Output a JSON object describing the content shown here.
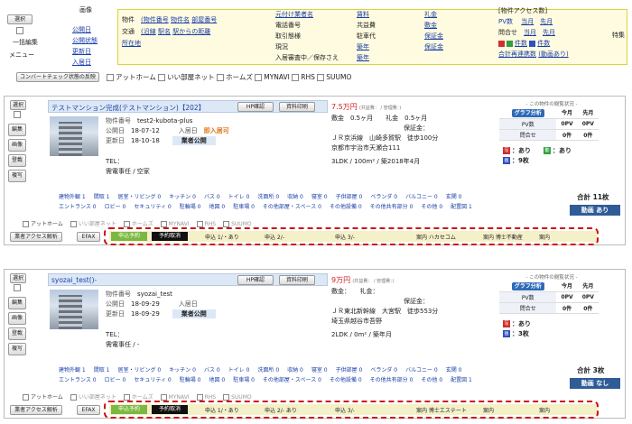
{
  "header": {
    "select_label": "選択",
    "bulk_edit": "一括編集",
    "menu": "メニュー",
    "col_image": {
      "title": "画像",
      "links": [
        "公開日",
        "公開状態",
        "更新日",
        "入居日"
      ]
    },
    "col_property": {
      "rows": [
        [
          "物件",
          "(物件番号",
          "物件名",
          "部屋番号"
        ],
        [
          "交通",
          "(沿線",
          "駅名",
          "駅からの距離"
        ],
        [
          "所在地",
          ""
        ]
      ]
    },
    "col_owner": {
      "items": [
        "元付け業者名",
        "電話番号",
        "取引態様",
        "現況",
        "入居審査中／保存さえ"
      ]
    },
    "col_price": {
      "items": [
        "賃料",
        "共益費",
        "駐車代",
        "築年",
        "築年"
      ]
    },
    "col_deposit": {
      "items": [
        "礼金",
        "敷金",
        "保証金",
        "保証金"
      ]
    },
    "access_title": "[物件アクセス数]",
    "pv_label": "PV数",
    "pv_links": [
      "当月",
      "先月"
    ],
    "inquiry_label": "問合せ",
    "inquiry_links": [
      "当月",
      "先月"
    ],
    "site_count": "件数",
    "site_count2": "件数",
    "total_link": "合計再連携数",
    "total_link2": "(動画あり)",
    "special": "特集",
    "convert_btn": "コンバートチェック状態の反映",
    "portal_checks": [
      "アットホーム",
      "いい部屋ネット",
      "ホームズ",
      "MYNAVI",
      "RHS",
      "SUUMO"
    ]
  },
  "cards": [
    {
      "select": "選択",
      "side_buttons": [
        "編集",
        "画像",
        "登載",
        "複写"
      ],
      "title": "テストマンション完成(テストマンション)【202】",
      "hp_btn": "HP確認",
      "print_btn": "資料印刷",
      "prop_no_label": "物件番号",
      "prop_no": "test2-kubota-plus",
      "pub_label": "公開日",
      "pub_date": "18-07-12",
      "move_label": "入居日",
      "move_val": "即入居可",
      "upd_label": "更新日",
      "upd_date": "18-10-18",
      "status": "業者公開",
      "tel": "TEL：",
      "agent": "需電事任 / 空家",
      "price": "7.5万円",
      "price_note": "(共益費： / 管理費：)",
      "deposit": "敷金　0.5ヶ月",
      "key_money": "礼金　0.5ヶ月",
      "guarantee": "保証金：",
      "station": "ＪＲ京浜線　山崎多賀駅　徒歩100分",
      "address": "京都市宇治市天瀬合111",
      "spec": "3LDK / 100m² / 築2018年4月",
      "stat_title": "- この物件の閲覧状況 -",
      "graph_btn": "グラフ分析",
      "th_this": "今月",
      "th_prev": "先月",
      "pv_label": "PV数",
      "pv_this": "0PV",
      "pv_prev": "0PV",
      "inq_label": "問合せ",
      "inq_this": "0件",
      "inq_prev": "0件",
      "badges": [
        {
          "icon": "写",
          "text": "：あり",
          "color": "#d03030"
        },
        {
          "icon": "動",
          "text": "：あり",
          "color": "#30a040"
        },
        {
          "icon": "画",
          "text": "：9枚",
          "color": "#3050c0"
        }
      ],
      "features": [
        "建物外観 1",
        "間取 1",
        "居室・リビング 0",
        "キッチン 0",
        "バス 0",
        "トイレ 0",
        "洗面所 0",
        "収納 0",
        "寝室 0",
        "子供部屋 0",
        "ベランダ 0",
        "バルコニー 0",
        "玄関 0",
        "エントランス 0",
        "ロビー 0",
        "セキュリティ 0",
        "駐輪場 0",
        "地図 0",
        "駐車場 0",
        "その他部屋・スペース 0",
        "その他設備 0",
        "その他共有部分 0",
        "その他 0",
        "配置図 1"
      ],
      "total": "合計 11枚",
      "video": "動画 あり",
      "portals": [
        "アットホーム",
        "いい部屋ネット",
        "ホームズ",
        "MYNAVI",
        "RHS",
        "SUUMO"
      ],
      "access_btn": "業者アクセス解析",
      "efax": "EFAX",
      "reserve": "申込予約",
      "cancel": "予約取消",
      "apps": [
        "申込 1/・あり",
        "申込 2/-",
        "申込 3/-"
      ],
      "guides": [
        "案内 ハカセコム",
        "案内 博士不動産",
        "案内"
      ]
    },
    {
      "select": "選択",
      "side_buttons": [
        "編集",
        "画像",
        "登載",
        "複写"
      ],
      "title": "syozai_test()-",
      "hp_btn": "HP確認",
      "print_btn": "資料印刷",
      "prop_no_label": "物件番号",
      "prop_no": "syozai_test",
      "pub_label": "公開日",
      "pub_date": "18-09-29",
      "move_label": "入居日",
      "move_val": "",
      "upd_label": "更新日",
      "upd_date": "18-09-29",
      "status": "業者公開",
      "tel": "TEL：",
      "agent": "需電事任 / -",
      "price": "9万円",
      "price_note": "(共益費： / 管理費：)",
      "deposit": "敷金：",
      "key_money": "礼金：",
      "guarantee": "保証金：",
      "station": "ＪＲ東北新幹線　大宮駅　徒歩553分",
      "address": "埼玉県越谷市吾野",
      "spec": "2LDK / 0m² / 築年月",
      "stat_title": "- この物件の閲覧状況 -",
      "graph_btn": "グラフ分析",
      "th_this": "今月",
      "th_prev": "先月",
      "pv_label": "PV数",
      "pv_this": "0PV",
      "pv_prev": "0PV",
      "inq_label": "問合せ",
      "inq_this": "0件",
      "inq_prev": "0件",
      "badges": [
        {
          "icon": "写",
          "text": "：あり",
          "color": "#d03030"
        },
        {
          "icon": "画",
          "text": "：3枚",
          "color": "#3050c0"
        }
      ],
      "features": [
        "建物外観 1",
        "間取 1",
        "居室・リビング 0",
        "キッチン 0",
        "バス 0",
        "トイレ 0",
        "洗面所 0",
        "収納 0",
        "寝室 0",
        "子供部屋 0",
        "ベランダ 0",
        "バルコニー 0",
        "玄関 0",
        "エントランス 0",
        "ロビー 0",
        "セキュリティ 0",
        "駐輪場 0",
        "地図 0",
        "駐車場 0",
        "その他部屋・スペース 0",
        "その他設備 0",
        "その他共有部分 0",
        "その他 0",
        "配置図 1"
      ],
      "total": "合計 3枚",
      "video": "動画 なし",
      "portals": [
        "アットホーム",
        "いい部屋ネット",
        "ホームズ",
        "MYNAVI",
        "RHS",
        "SUUMO"
      ],
      "access_btn": "業者アクセス解析",
      "efax": "EFAX",
      "reserve": "申込予約",
      "cancel": "予約取消",
      "apps": [
        "申込 1/・あり",
        "申込 2/- あり",
        "申込 3/-"
      ],
      "guides": [
        "案内 博士エステート",
        "案内",
        "案内"
      ]
    }
  ]
}
